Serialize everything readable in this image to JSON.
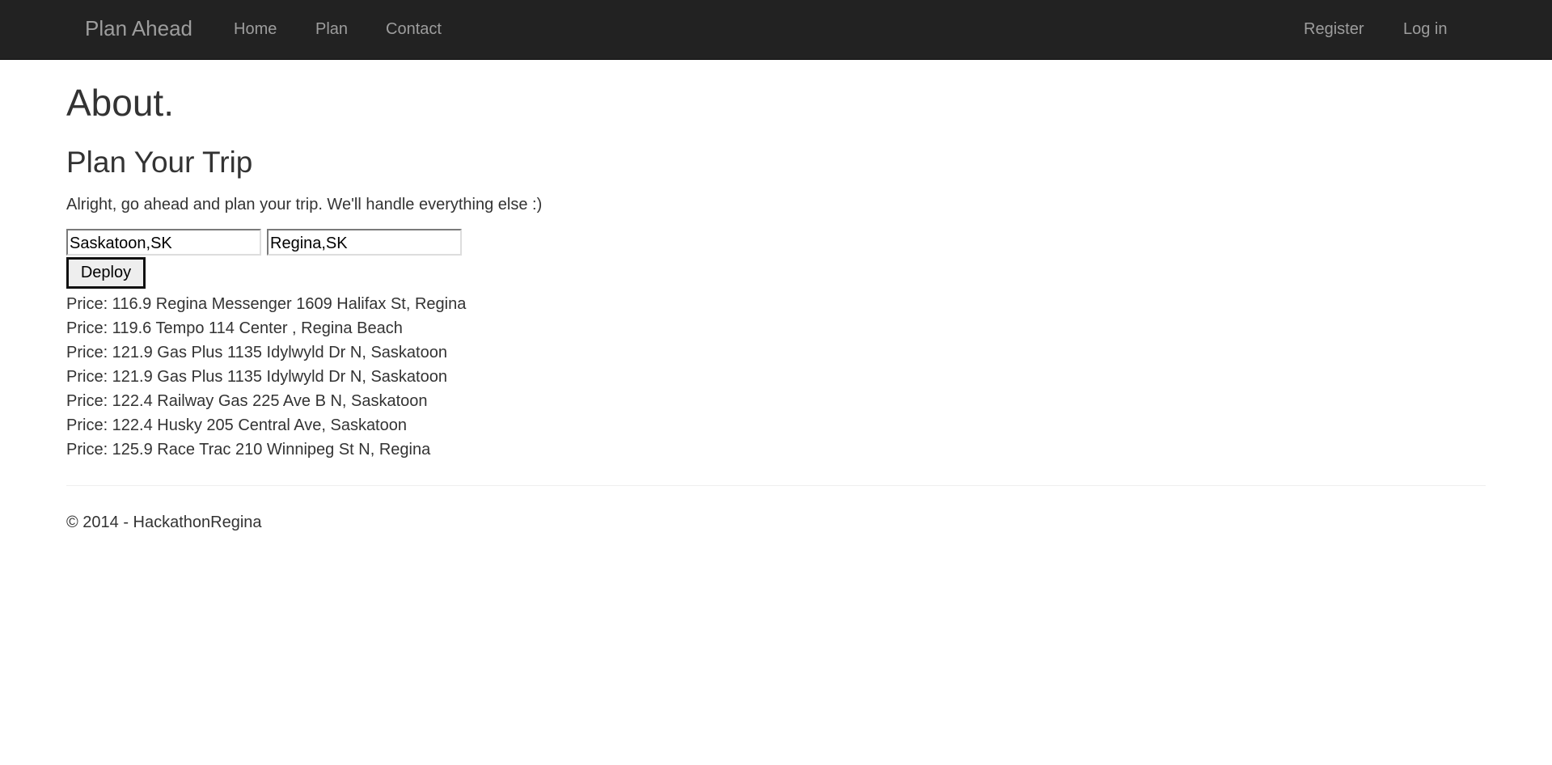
{
  "navbar": {
    "brand": "Plan Ahead",
    "links": {
      "home": "Home",
      "plan": "Plan",
      "contact": "Contact"
    },
    "account": {
      "register": "Register",
      "login": "Log in"
    }
  },
  "main": {
    "title": "About.",
    "subtitle": "Plan Your Trip",
    "intro": "Alright, go ahead and plan your trip. We'll handle everything else :)",
    "form": {
      "origin_value": "Saskatoon,SK",
      "destination_value": "Regina,SK",
      "submit_label": "Deploy"
    },
    "results": [
      "Price: 116.9 Regina Messenger 1609 Halifax St, Regina",
      "Price: 119.6 Tempo 114 Center , Regina Beach",
      "Price: 121.9 Gas Plus 1135 Idylwyld Dr N, Saskatoon",
      "Price: 121.9 Gas Plus 1135 Idylwyld Dr N, Saskatoon",
      "Price: 122.4 Railway Gas 225 Ave B N, Saskatoon",
      "Price: 122.4 Husky 205 Central Ave, Saskatoon",
      "Price: 125.9 Race Trac 210 Winnipeg St N, Regina"
    ]
  },
  "footer": {
    "copyright": "© 2014 - HackathonRegina"
  },
  "colors": {
    "navbar_bg": "#222222",
    "nav_text": "#9d9d9d",
    "body_text": "#333333"
  }
}
